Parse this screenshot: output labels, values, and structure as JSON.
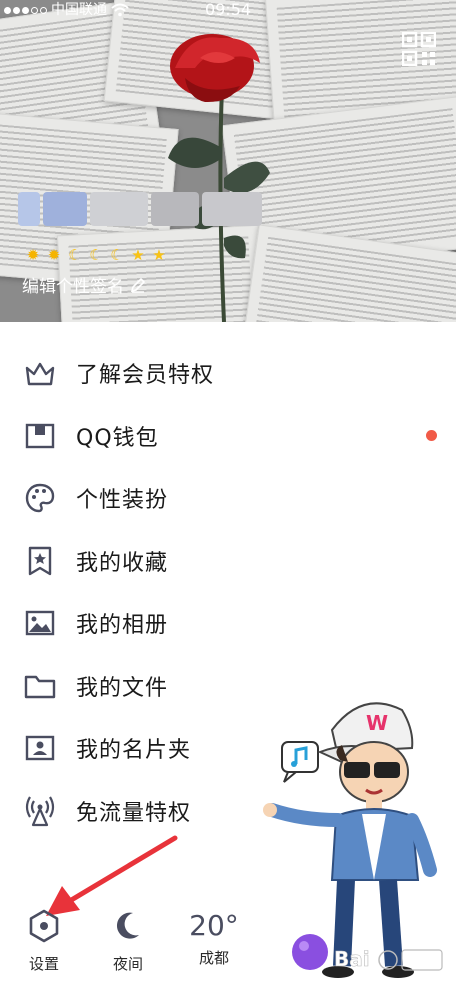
{
  "status_bar": {
    "carrier": "中国联通",
    "time": "09:54"
  },
  "profile": {
    "signature": "编辑个性签名",
    "level_icons": [
      "sun-icon",
      "sun-icon",
      "moon-icon",
      "moon-icon",
      "moon-icon",
      "star-icon",
      "star-icon"
    ]
  },
  "menu": {
    "items": [
      {
        "label": "了解会员特权",
        "icon": "crown-icon"
      },
      {
        "label": "QQ钱包",
        "icon": "wallet-icon",
        "badge": true
      },
      {
        "label": "个性装扮",
        "icon": "palette-icon"
      },
      {
        "label": "我的收藏",
        "icon": "bookmark-star-icon"
      },
      {
        "label": "我的相册",
        "icon": "picture-icon"
      },
      {
        "label": "我的文件",
        "icon": "folder-icon"
      },
      {
        "label": "我的名片夹",
        "icon": "contact-card-icon"
      },
      {
        "label": "免流量特权",
        "icon": "signal-tower-icon"
      }
    ]
  },
  "bottom_bar": {
    "settings_label": "设置",
    "night_label": "夜间",
    "temperature": "20°",
    "city": "成都"
  },
  "colors": {
    "icon_color": "#4a4d60",
    "badge_color": "#f15a47",
    "arrow_color": "#e8333a"
  }
}
